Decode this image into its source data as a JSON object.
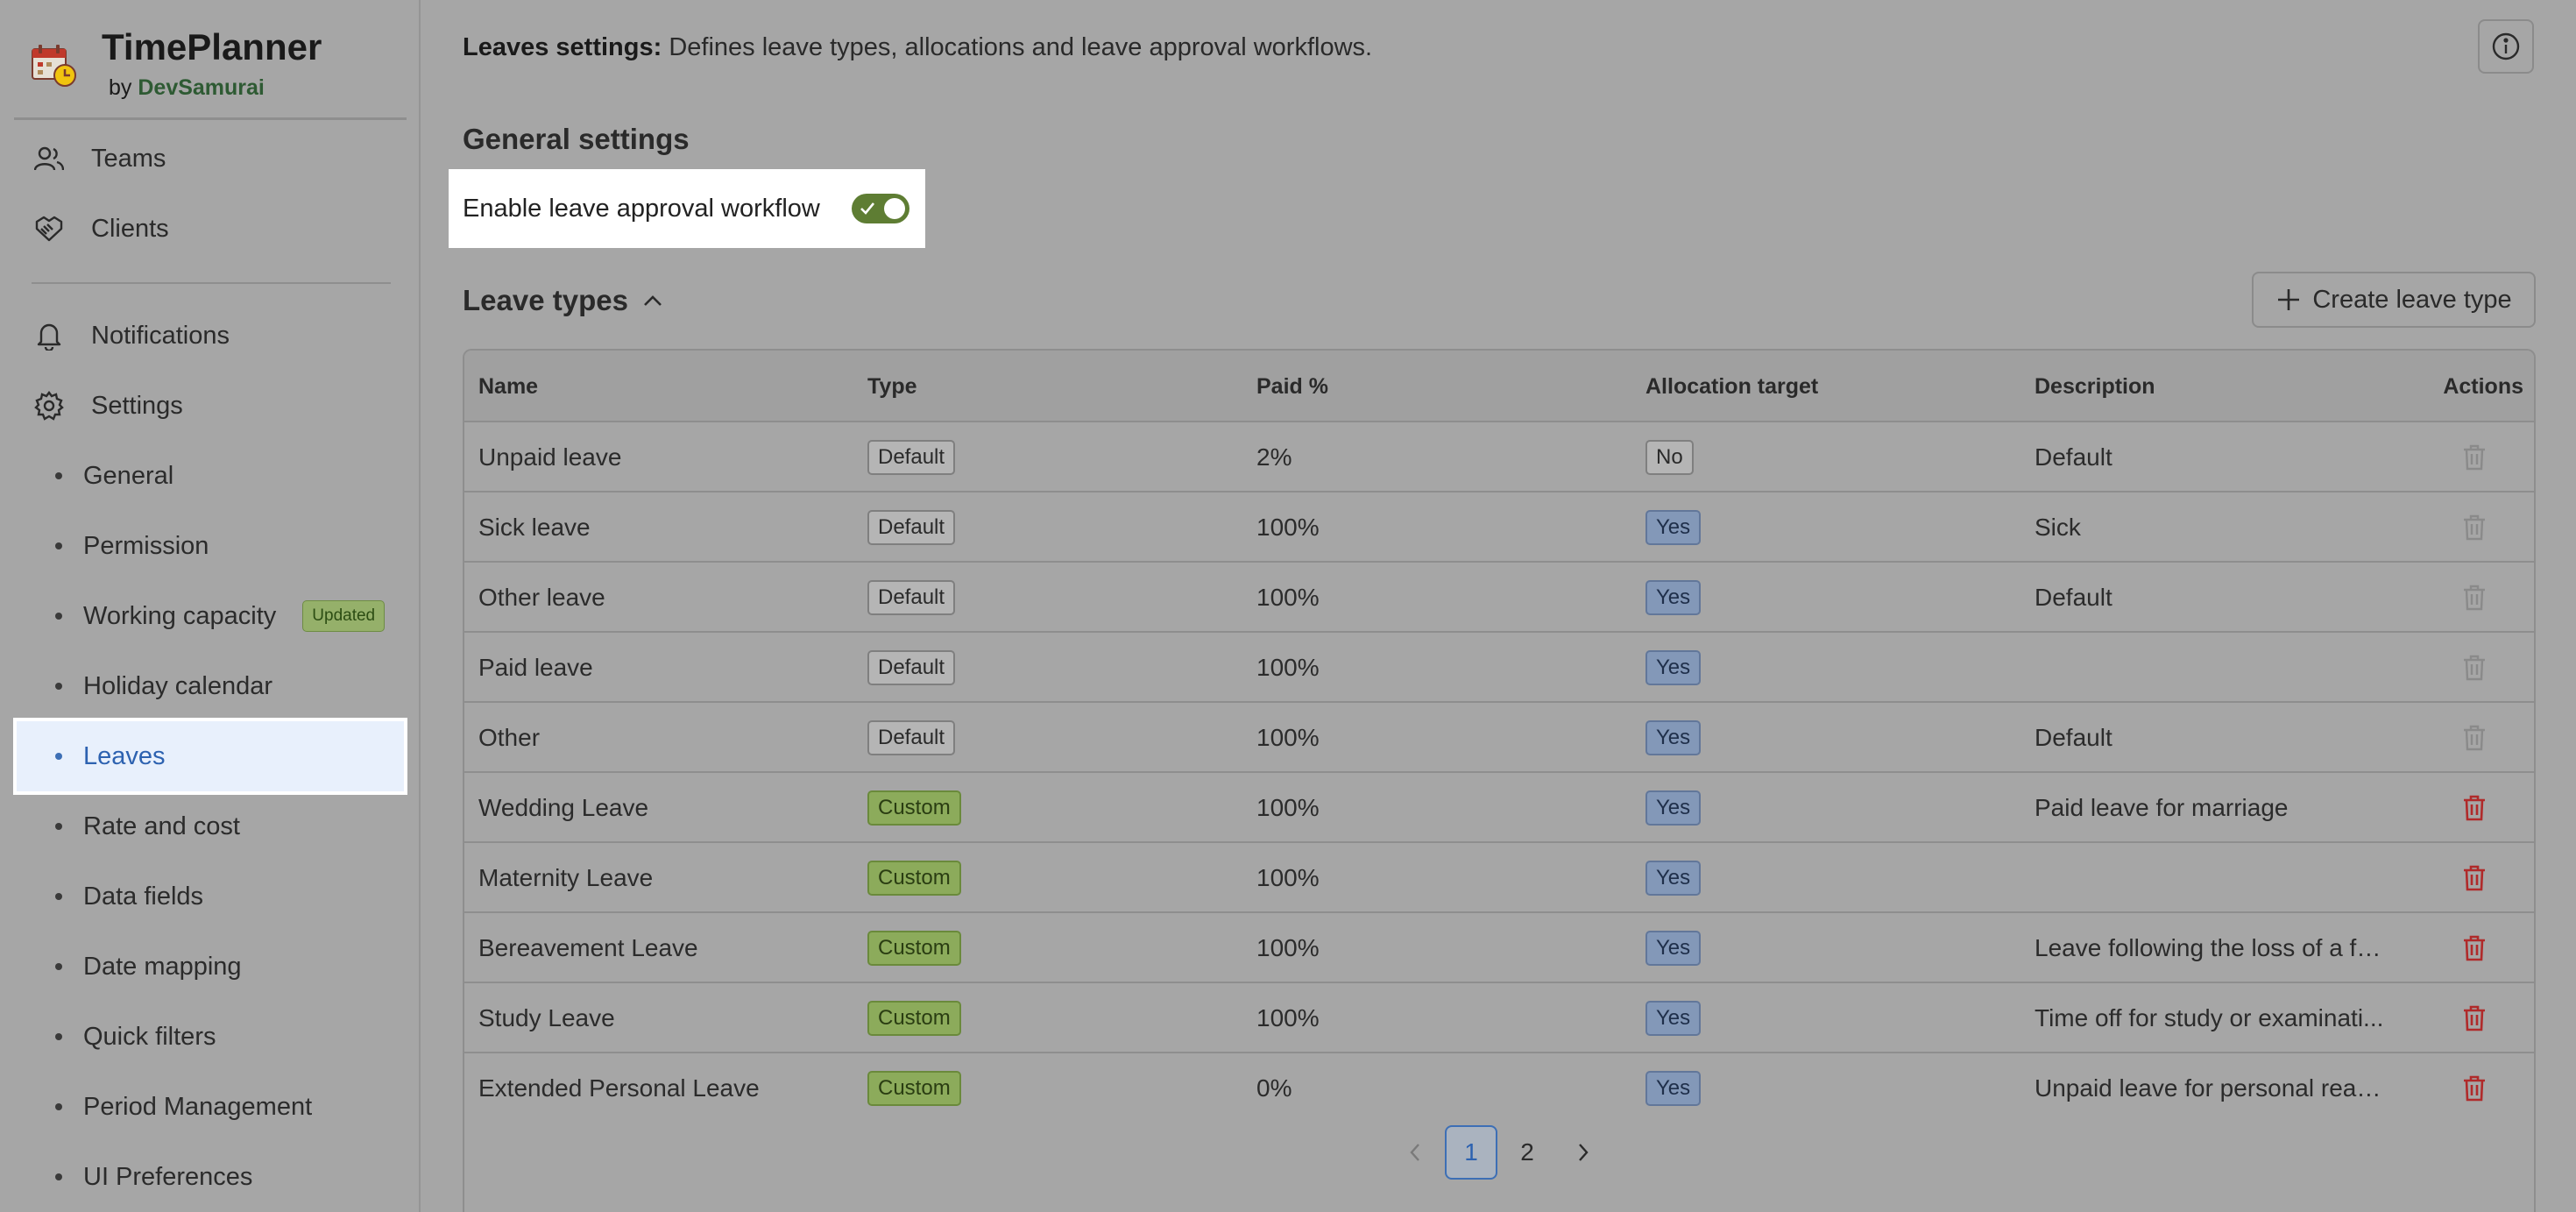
{
  "app": {
    "name": "TimePlanner",
    "by_prefix": "by",
    "by_vendor": "DevSamurai"
  },
  "sidebar": {
    "nav": [
      {
        "label": "Teams",
        "icon": "users-icon"
      },
      {
        "label": "Clients",
        "icon": "handshake-icon"
      },
      {
        "label": "Notifications",
        "icon": "bell-icon"
      },
      {
        "label": "Settings",
        "icon": "gear-icon"
      }
    ],
    "settings_items": [
      {
        "label": "General"
      },
      {
        "label": "Permission"
      },
      {
        "label": "Working capacity",
        "badge": "Updated"
      },
      {
        "label": "Holiday calendar"
      },
      {
        "label": "Leaves",
        "active": true
      },
      {
        "label": "Rate and cost"
      },
      {
        "label": "Data fields"
      },
      {
        "label": "Date mapping"
      },
      {
        "label": "Quick filters"
      },
      {
        "label": "Period Management"
      },
      {
        "label": "UI Preferences"
      }
    ]
  },
  "header": {
    "title": "Leaves settings:",
    "description": "Defines leave types, allocations and leave approval workflows."
  },
  "general_settings": {
    "title": "General settings",
    "approval_toggle_label": "Enable leave approval workflow",
    "approval_enabled": true
  },
  "leave_types": {
    "title": "Leave types",
    "create_button": "Create leave type",
    "columns": {
      "name": "Name",
      "type": "Type",
      "paid": "Paid %",
      "allocation": "Allocation target",
      "description": "Description",
      "actions": "Actions"
    },
    "rows": [
      {
        "name": "Unpaid leave",
        "type": "Default",
        "paid": "2%",
        "allocation": "No",
        "description": "Default"
      },
      {
        "name": "Sick leave",
        "type": "Default",
        "paid": "100%",
        "allocation": "Yes",
        "description": "Sick"
      },
      {
        "name": "Other leave",
        "type": "Default",
        "paid": "100%",
        "allocation": "Yes",
        "description": "Default"
      },
      {
        "name": "Paid leave",
        "type": "Default",
        "paid": "100%",
        "allocation": "Yes",
        "description": ""
      },
      {
        "name": "Other",
        "type": "Default",
        "paid": "100%",
        "allocation": "Yes",
        "description": "Default"
      },
      {
        "name": "Wedding Leave",
        "type": "Custom",
        "paid": "100%",
        "allocation": "Yes",
        "description": "Paid leave for marriage"
      },
      {
        "name": "Maternity Leave",
        "type": "Custom",
        "paid": "100%",
        "allocation": "Yes",
        "description": ""
      },
      {
        "name": "Bereavement Leave",
        "type": "Custom",
        "paid": "100%",
        "allocation": "Yes",
        "description": "Leave following the loss of a fa..."
      },
      {
        "name": "Study Leave",
        "type": "Custom",
        "paid": "100%",
        "allocation": "Yes",
        "description": "Time off for study or examinati..."
      },
      {
        "name": "Extended Personal Leave",
        "type": "Custom",
        "paid": "0%",
        "allocation": "Yes",
        "description": "Unpaid leave for personal reas..."
      }
    ]
  },
  "pagination": {
    "pages": [
      "1",
      "2"
    ],
    "current": "1"
  },
  "colors": {
    "accent_blue": "#2d62b0",
    "toggle_on": "#5e7d33",
    "delete_red": "#b02a2a",
    "delete_disabled": "#8a8a8a"
  }
}
